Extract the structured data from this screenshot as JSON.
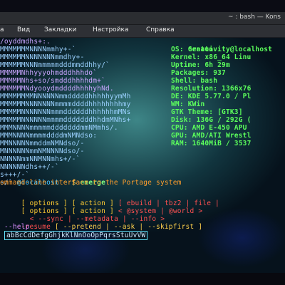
{
  "window": {
    "title": "~ : bash — Kons"
  },
  "menu": {
    "items": [
      "а",
      "Вид",
      "Закладки",
      "Настройка",
      "Справка"
    ]
  },
  "logo_lines": [
    "/oyddmdhs+:.",
    "MMMMMMMNNNNmmhy+-`",
    "MMMMMMNNNNNNNmmdhy+-",
    "MMMMMMNNNmmmmmdddmmddhhy/`",
    "MMMMMNhhyyyohmdddhhhdo`",
    "MMMMMNhs+so/smdddhhhhdm+`",
    "MMMMMMNdyooydmddddhhhhyhNd.",
    "MMMMMMMMNNNNNNmmdddddhhhhhyymMh",
    "MMMMMMNNNNNNNmmmmddddhhhhhhhhmy",
    "MMMMMNNNNNNNmmmddddddhhhhhhmMNs",
    "MMMMMNNNNNNmmmmdddddddhhdmMNhs+",
    "MMMNNNNmmmmmdddddddmmNMmhs/.",
    "MMMNNNNmmmmddddmNMNdso:",
    "MMNNNNNmmddmNMNdso/-",
    "MNNNNNNmmNMNNNNdso/-",
    "NNNNNmmNNMNNmhs+/-`",
    "NNNNNNdhs++/-`",
    "s+++/-`",
    "s/`"
  ],
  "info": [
    {
      "key": "creativity@localhost",
      "val": ""
    },
    {
      "key": "OS:",
      "val": "Gentoo"
    },
    {
      "key": "Kernel:",
      "val": "x86_64 Linu"
    },
    {
      "key": "Uptime:",
      "val": "6h 29m"
    },
    {
      "key": "Packages:",
      "val": "937"
    },
    {
      "key": "Shell:",
      "val": "bash"
    },
    {
      "key": "Resolution:",
      "val": "1366x76"
    },
    {
      "key": "DE:",
      "val": "KDE 5.77.0 / Pl"
    },
    {
      "key": "WM:",
      "val": "KWin"
    },
    {
      "key": "GTK Theme:",
      "val": "[GTK3]"
    },
    {
      "key": "Disk:",
      "val": "136G / 292G ("
    },
    {
      "key": "CPU:",
      "val": "AMD E-450 APU"
    },
    {
      "key": "GPU:",
      "val": "AMD/ATI Wrestl"
    },
    {
      "key": "RAM:",
      "val": "1640MiB / 3537"
    }
  ],
  "prompt": {
    "host": "@localhost",
    "tilde": "~",
    "dollar": "$",
    "command": "emerge"
  },
  "help": {
    "desc": "ommand-line interface to the Portage system"
  },
  "usage": {
    "row1": [
      "[ options ]",
      "[ action ]",
      "[ ebuild",
      "| tbz2",
      "| file",
      "|"
    ],
    "row2": [
      "[ options ]",
      "[ action ]",
      "< @system",
      "| @world",
      ">"
    ],
    "row3": [
      "< --sync",
      "| --metadata",
      "| --info",
      ">"
    ],
    "row4": [
      "--resume",
      "[ --pretend",
      "| --ask",
      "| --skipfirst",
      "]"
    ],
    "row5": "--help"
  },
  "charset": "abBcCdDefgGhjkKlNnOoOpPqrsStuUvVW"
}
